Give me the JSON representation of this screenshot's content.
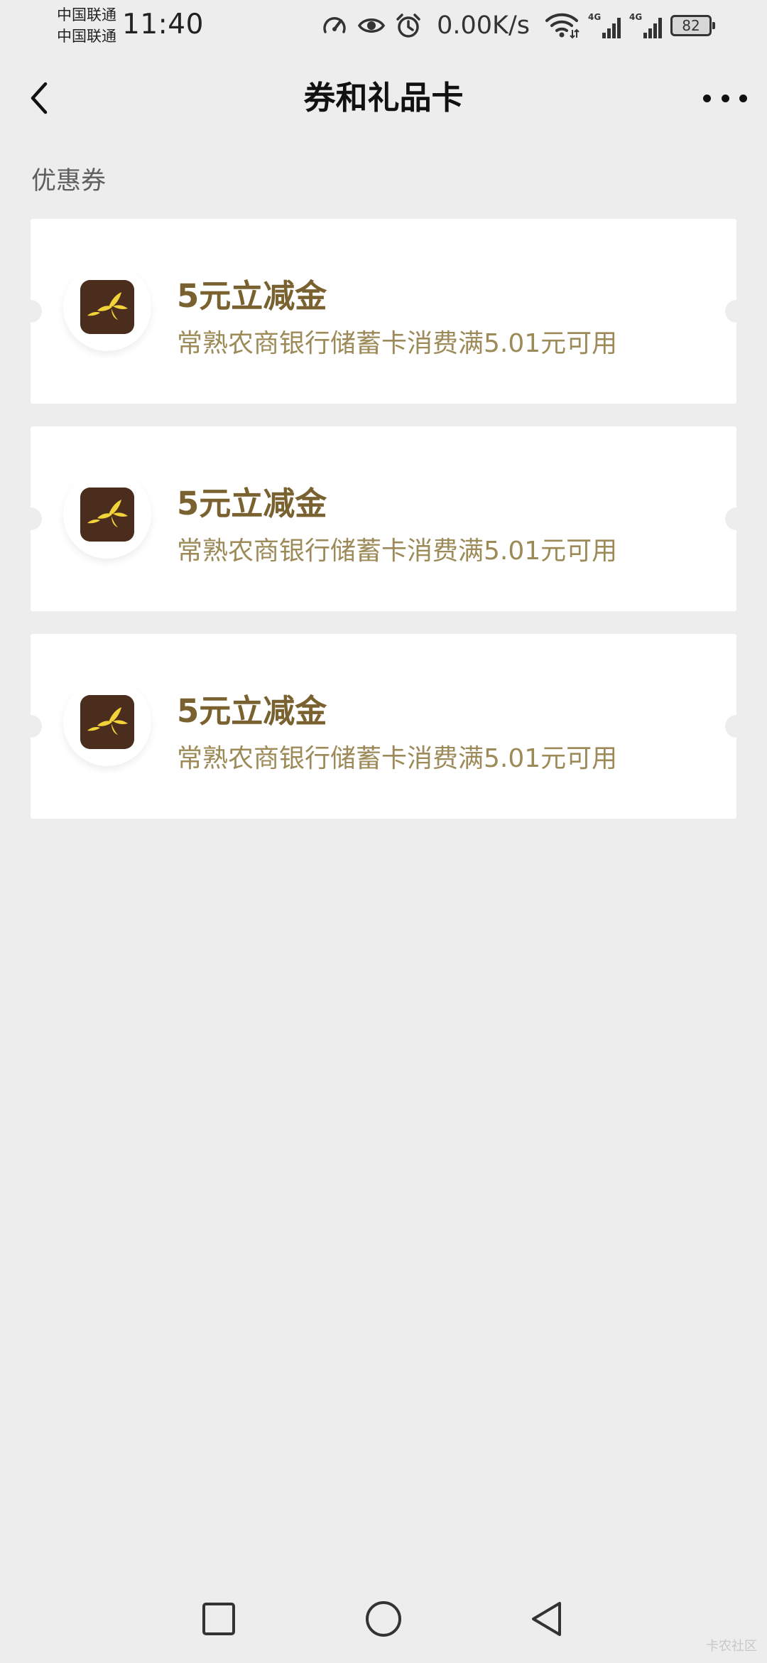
{
  "status_bar": {
    "carrier_1": "中国联通",
    "carrier_2": "中国联通",
    "time": "11:40",
    "net_speed": "0.00K/s",
    "network_1": "4G",
    "network_2": "4G",
    "battery": "82",
    "icons": [
      "speed-gauge-icon",
      "eye-icon",
      "alarm-icon",
      "wifi-icon",
      "signal-icon",
      "signal-icon",
      "battery-icon"
    ]
  },
  "header": {
    "title": "券和礼品卡",
    "back_icon": "chevron-left-icon",
    "more_icon": "more-dots-icon"
  },
  "section": {
    "title": "优惠券"
  },
  "coupons": [
    {
      "title": "5元立减金",
      "description": "常熟农商银行储蓄卡消费满5.01元可用",
      "logo_icon": "bank-logo-icon"
    },
    {
      "title": "5元立减金",
      "description": "常熟农商银行储蓄卡消费满5.01元可用",
      "logo_icon": "bank-logo-icon"
    },
    {
      "title": "5元立减金",
      "description": "常熟农商银行储蓄卡消费满5.01元可用",
      "logo_icon": "bank-logo-icon"
    }
  ],
  "system_nav": {
    "icons": [
      "recent-apps-icon",
      "home-icon",
      "back-triangle-icon"
    ]
  },
  "watermark": "卡农社区",
  "colors": {
    "background": "#ededed",
    "card": "#ffffff",
    "coupon_title": "#7a6230",
    "coupon_description": "#9c8a58",
    "logo_background": "#4a2d1c",
    "logo_birds": "#f2d43a"
  }
}
